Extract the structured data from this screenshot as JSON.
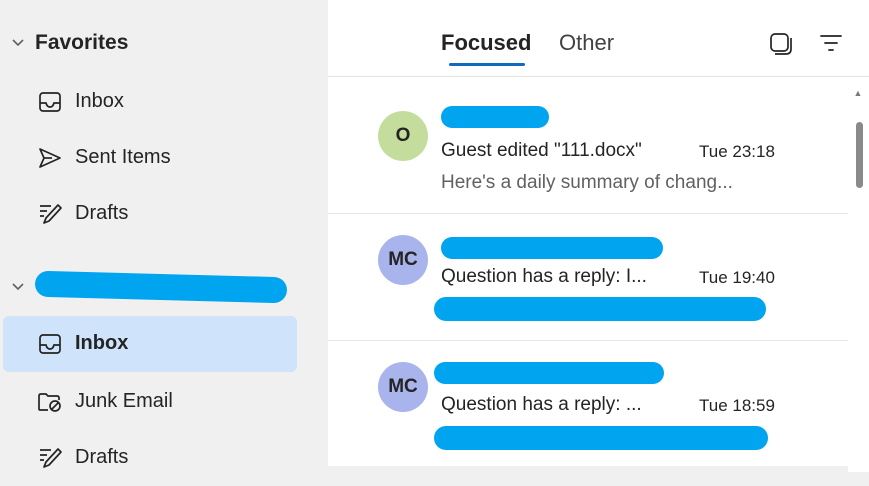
{
  "sidebar": {
    "favorites": {
      "title": "Favorites",
      "items": [
        {
          "label": "Inbox",
          "icon": "inbox-icon"
        },
        {
          "label": "Sent Items",
          "icon": "send-icon"
        },
        {
          "label": "Drafts",
          "icon": "drafts-icon"
        }
      ]
    },
    "account": {
      "items": [
        {
          "label": "Inbox",
          "icon": "inbox-icon",
          "selected": true
        },
        {
          "label": "Junk Email",
          "icon": "junk-folder-icon"
        },
        {
          "label": "Drafts",
          "icon": "drafts-icon"
        }
      ]
    }
  },
  "header": {
    "tabs": [
      {
        "label": "Focused",
        "active": true
      },
      {
        "label": "Other",
        "active": false
      }
    ],
    "tools": [
      "select-mode-icon",
      "filter-icon"
    ]
  },
  "messages": [
    {
      "avatar_initials": "O",
      "avatar_color": "#c5dd9c",
      "subject": "Guest edited \"111.docx\"",
      "time": "Tue 23:18",
      "preview": "Here's a daily summary of chang..."
    },
    {
      "avatar_initials": "MC",
      "avatar_color": "#a9b4ec",
      "subject": "Question has a reply: I...",
      "time": "Tue 19:40",
      "preview": ""
    },
    {
      "avatar_initials": "MC",
      "avatar_color": "#a9b4ec",
      "subject": "Question has a reply: ...",
      "time": "Tue 18:59",
      "preview": ""
    }
  ],
  "colors": {
    "accent": "#0f6cbd",
    "selected_bg": "#cfe4fa",
    "redaction": "#00a4ef"
  }
}
